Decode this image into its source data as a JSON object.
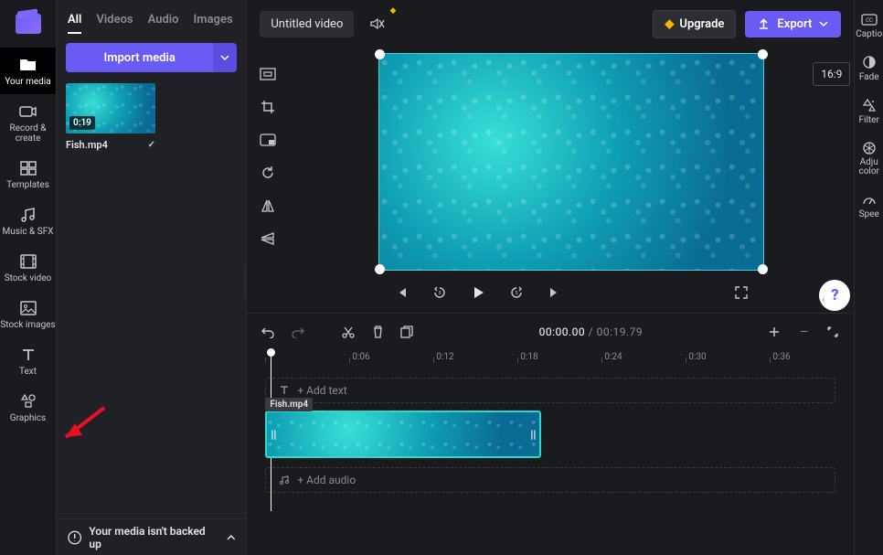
{
  "rail": {
    "items": [
      {
        "label": "Your media"
      },
      {
        "label": "Record & create"
      },
      {
        "label": "Templates"
      },
      {
        "label": "Music & SFX"
      },
      {
        "label": "Stock video"
      },
      {
        "label": "Stock images"
      },
      {
        "label": "Text"
      },
      {
        "label": "Graphics"
      }
    ]
  },
  "panel": {
    "tabs": {
      "all": "All",
      "videos": "Videos",
      "audio": "Audio",
      "images": "Images"
    },
    "import_label": "Import media",
    "thumb": {
      "duration": "0:19",
      "name": "Fish.mp4"
    },
    "footer": "Your media isn't backed up"
  },
  "topbar": {
    "title": "Untitled video",
    "upgrade": "Upgrade",
    "export": "Export"
  },
  "preview": {
    "ratio": "16:9"
  },
  "timeline": {
    "current": "00:00.00",
    "total": "00:19.79",
    "ticks": [
      "",
      "0:06",
      "0:12",
      "0:18",
      "0:24",
      "0:30",
      "0:36"
    ],
    "add_text": "+ Add text",
    "add_audio": "+ Add audio",
    "clip_label": "Fish.mp4"
  },
  "right_rail": {
    "items": [
      {
        "label": "Captio"
      },
      {
        "label": "Fade"
      },
      {
        "label": "Filter"
      },
      {
        "label": "Adju color"
      },
      {
        "label": "Spee"
      }
    ]
  }
}
